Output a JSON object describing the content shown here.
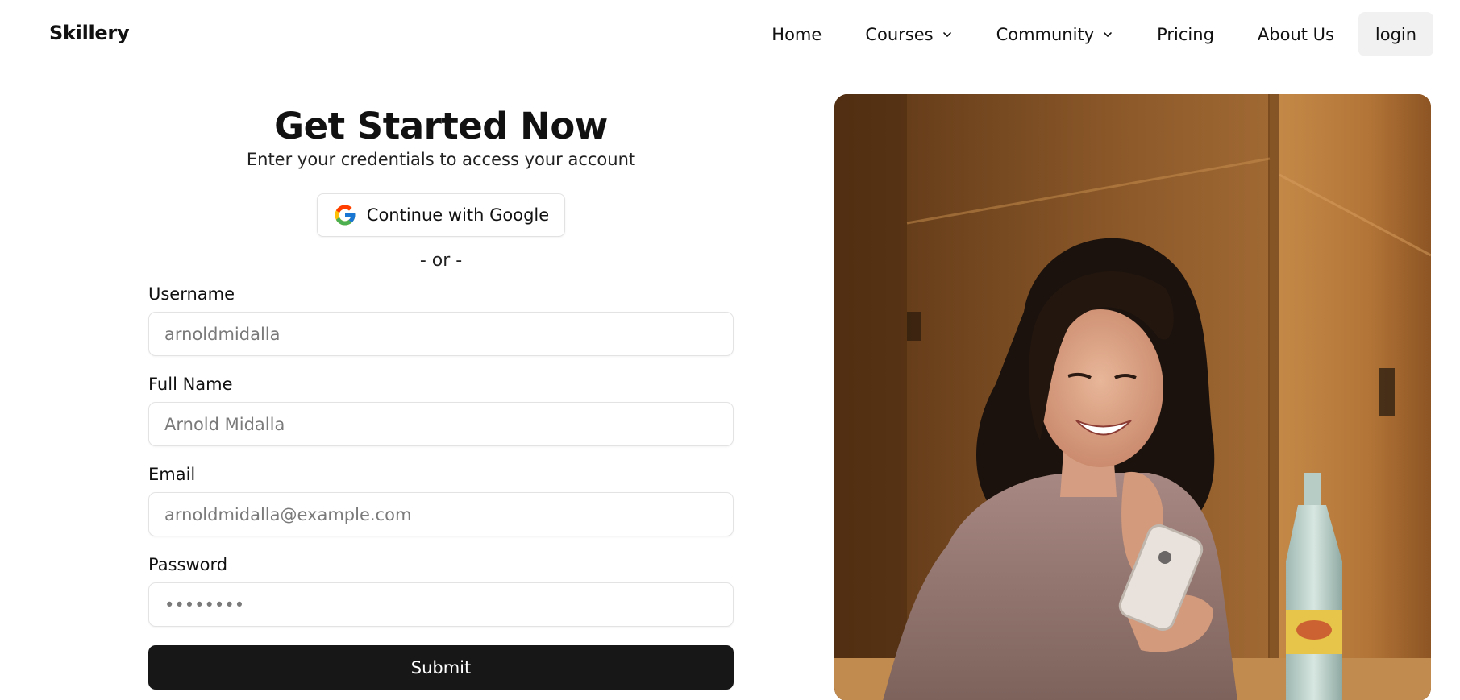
{
  "app": {
    "brand": "Skillery"
  },
  "nav": {
    "items": [
      {
        "label": "Home",
        "has_dropdown": false
      },
      {
        "label": "Courses",
        "has_dropdown": true
      },
      {
        "label": "Community",
        "has_dropdown": true
      },
      {
        "label": "Pricing",
        "has_dropdown": false
      },
      {
        "label": "About Us",
        "has_dropdown": false
      }
    ],
    "login_label": "login"
  },
  "form": {
    "title": "Get Started Now",
    "subtitle": "Enter your credentials to access your account",
    "google_label": "Continue with Google",
    "divider": "- or -",
    "fields": [
      {
        "label": "Username",
        "placeholder": "arnoldmidalla",
        "type": "text"
      },
      {
        "label": "Full Name",
        "placeholder": "Arnold Midalla",
        "type": "text"
      },
      {
        "label": "Email",
        "placeholder": "arnoldmidalla@example.com",
        "type": "email"
      },
      {
        "label": "Password",
        "placeholder": "••••••••",
        "type": "password"
      }
    ],
    "submit_label": "Submit"
  },
  "hero_image": {
    "subject": "woman-smiling-at-phone-photo"
  },
  "colors": {
    "primary_button": "#171717",
    "login_bg": "#f1f1f1",
    "input_border": "#e3e3e3",
    "google_blue": "#4285F4",
    "google_red": "#EA4335",
    "google_yellow": "#FBBC05",
    "google_green": "#34A853"
  }
}
